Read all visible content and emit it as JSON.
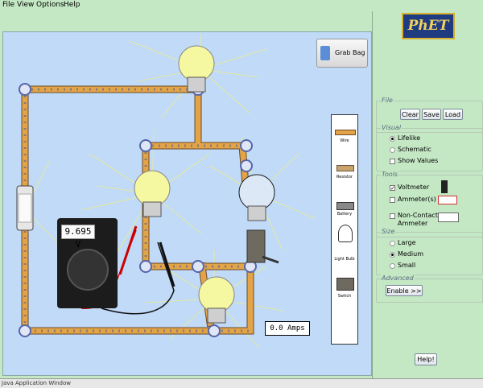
{
  "menu": {
    "file": "File",
    "view": "View",
    "options": "Options",
    "help": "Help"
  },
  "logo_text": "PhET",
  "canvas": {
    "grab_bag": "Grab Bag",
    "voltmeter_reading": "9.695 V",
    "ammeter_reading": "0.0 Amps"
  },
  "toolbox": {
    "wire": "Wire",
    "resistor": "Resistor",
    "battery": "Battery",
    "light_bulb": "Light Bulb",
    "switch": "Switch"
  },
  "panel": {
    "file": {
      "title": "File",
      "clear": "Clear",
      "save": "Save",
      "load": "Load"
    },
    "visual": {
      "title": "Visual",
      "lifelike": "Lifelike",
      "schematic": "Schematic",
      "show_values": "Show Values"
    },
    "tools": {
      "title": "Tools",
      "voltmeter": "Voltmeter",
      "ammeters": "Ammeter(s)",
      "non_contact_1": "Non-Contact",
      "non_contact_2": "Ammeter"
    },
    "size": {
      "title": "Size",
      "large": "Large",
      "medium": "Medium",
      "small": "Small"
    },
    "advanced": {
      "title": "Advanced",
      "enable": "Enable >>"
    },
    "help": "Help!"
  },
  "status": "Java Application Window",
  "colors": {
    "canvas": "#c0daf8",
    "panel": "#c4e8c4",
    "wire": "#e3a448",
    "wire_edge": "#6b4a2a",
    "junction": "#5566aa",
    "logo_bg": "#203c80"
  }
}
